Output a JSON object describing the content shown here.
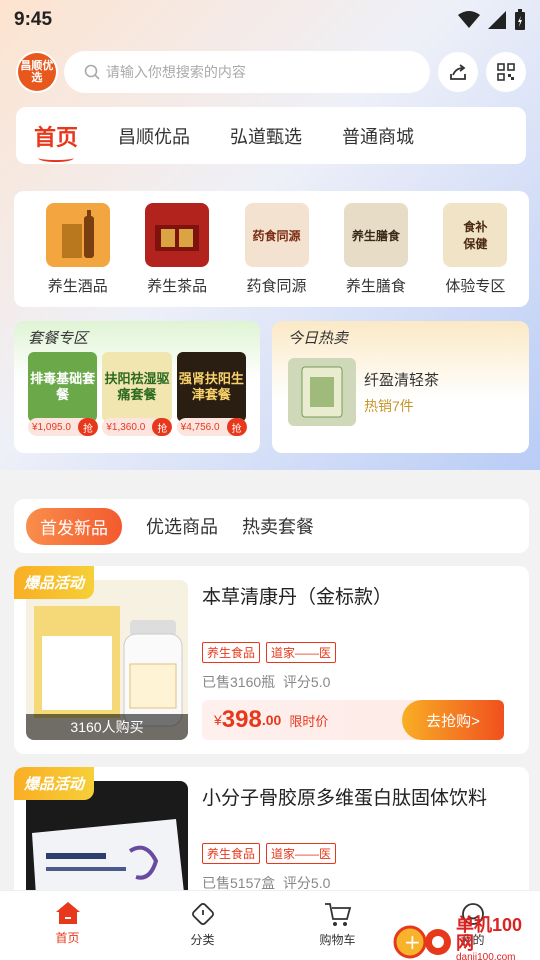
{
  "status": {
    "time": "9:45"
  },
  "header": {
    "logo_text": "昌顺优选",
    "search_placeholder": "请输入你想搜索的内容"
  },
  "top_tabs": [
    "首页",
    "昌顺优品",
    "弘道甄选",
    "普通商城"
  ],
  "categories": [
    {
      "label": "养生酒品",
      "icon": "liquor-gift-box",
      "color": "#f3a640"
    },
    {
      "label": "养生茶品",
      "icon": "tea-gift-box",
      "color": "#b3231e"
    },
    {
      "label": "药食同源",
      "icon": "herbal-food",
      "color": "#8b4a2b"
    },
    {
      "label": "养生膳食",
      "icon": "health-meal",
      "color": "#8e7a58"
    },
    {
      "label": "体验专区",
      "icon": "food-bowls",
      "color": "#b96b30"
    }
  ],
  "package_zone": {
    "title": "套餐专区",
    "items": [
      {
        "img_text": "排毒基础套餐",
        "price": "¥1,095.0",
        "btn": "抢",
        "bg": "#6aa84a",
        "fg": "#ffffff"
      },
      {
        "img_text": "扶阳祛湿驱痛套餐",
        "price": "¥1,360.0",
        "btn": "抢",
        "bg": "#f1e6b0",
        "fg": "#2d6a20"
      },
      {
        "img_text": "强肾扶阳生津套餐",
        "price": "¥4,756.0",
        "btn": "抢",
        "bg": "#2a1d12",
        "fg": "#f7d26a"
      }
    ]
  },
  "today_hot": {
    "title": "今日热卖",
    "product": "纤盈清轻茶",
    "sales": "热销7件"
  },
  "filter_tabs": [
    "首发新品",
    "优选商品",
    "热卖套餐"
  ],
  "products": [
    {
      "badge": "爆品活动",
      "name": "本草清康丹（金标款）",
      "tags": [
        "养生食品",
        "道家——医"
      ],
      "sold": "已售3160瓶",
      "rating": "评分5.0",
      "buyers": "3160人购买",
      "currency": "¥",
      "price_int": "398",
      "price_dec": ".00",
      "limit_label": "限时价",
      "cta": "去抢购>"
    },
    {
      "badge": "爆品活动",
      "name": "小分子骨胶原多维蛋白肽固体饮料",
      "tags": [
        "养生食品",
        "道家——医"
      ],
      "sold": "已售5157盒",
      "rating": "评分5.0"
    }
  ],
  "tabbar": [
    {
      "label": "首页",
      "icon": "home-icon"
    },
    {
      "label": "分类",
      "icon": "category-icon"
    },
    {
      "label": "购物车",
      "icon": "cart-icon"
    },
    {
      "label": "我的",
      "icon": "profile-icon"
    }
  ],
  "watermark": {
    "text": "单机100网",
    "url": "danji100.com"
  },
  "colors": {
    "accent": "#e8381c",
    "gold": "#c9962a",
    "badge": "#f9ae25"
  }
}
